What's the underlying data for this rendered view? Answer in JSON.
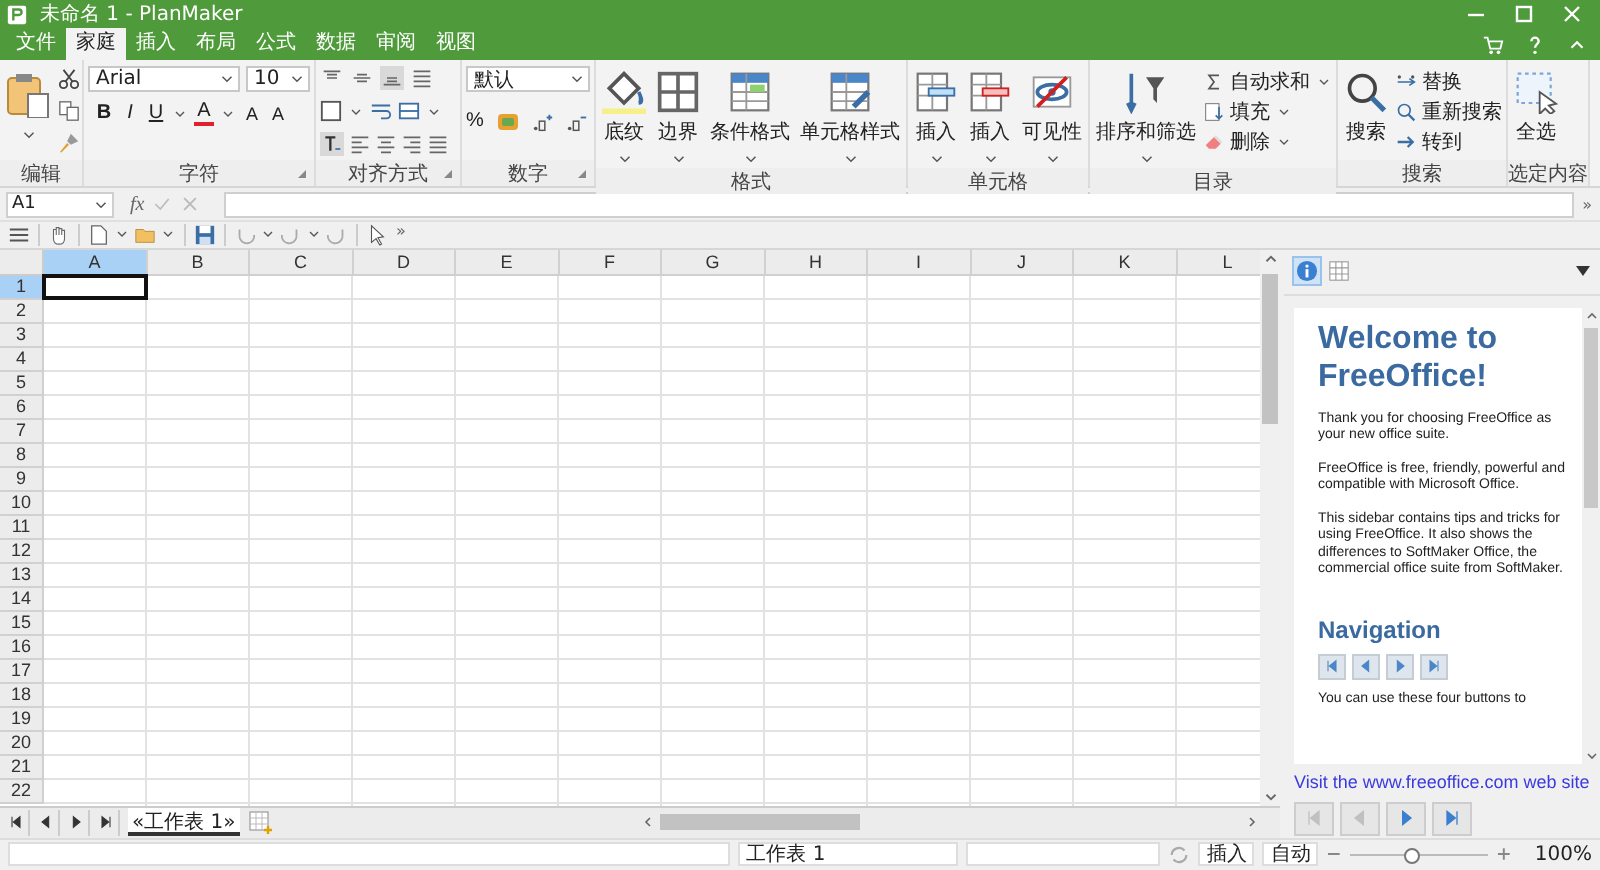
{
  "window": {
    "title": "未命名 1 - PlanMaker"
  },
  "ribbon_tabs": [
    {
      "label": "文件",
      "selected": false
    },
    {
      "label": "家庭",
      "selected": true
    },
    {
      "label": "插入",
      "selected": false
    },
    {
      "label": "布局",
      "selected": false
    },
    {
      "label": "公式",
      "selected": false
    },
    {
      "label": "数据",
      "selected": false
    },
    {
      "label": "审阅",
      "selected": false
    },
    {
      "label": "视图",
      "selected": false
    }
  ],
  "ribbon_groups": [
    {
      "kind": "edit",
      "label": "编辑"
    },
    {
      "kind": "character",
      "label": "字符",
      "font": "Arial",
      "size": "10",
      "buttons": [
        {
          "kind": "bold",
          "text": "B"
        },
        {
          "kind": "italic",
          "text": "I"
        },
        {
          "kind": "underline",
          "text": "U"
        },
        {
          "kind": "color",
          "text": "A"
        },
        {
          "kind": "grow",
          "text": "A"
        },
        {
          "kind": "shrink",
          "text": "A"
        }
      ]
    },
    {
      "kind": "alignment",
      "label": "对齐方式",
      "vertical": [
        {
          "selected": false
        },
        {
          "selected": false
        },
        {
          "selected": true
        },
        {
          "selected": false
        }
      ],
      "rotate_selected": true
    },
    {
      "kind": "number",
      "label": "数字",
      "format": "默认",
      "percent": "%"
    },
    {
      "kind": "large",
      "label": "格式",
      "buttons": [
        "底纹",
        "边界",
        "条件格式",
        "单元格样式"
      ]
    },
    {
      "kind": "large",
      "label": "单元格",
      "buttons": [
        "插入",
        "插入",
        "可见性"
      ]
    },
    {
      "kind": "mixed",
      "label": "目录",
      "large": "排序和筛选",
      "small": [
        "自动求和",
        "填充",
        "删除"
      ]
    },
    {
      "kind": "mixed",
      "label": "搜索",
      "large": "搜索",
      "small": [
        "替换",
        "重新搜索",
        "转到"
      ]
    },
    {
      "kind": "large",
      "label": "选定内容",
      "buttons": [
        "全选"
      ]
    }
  ],
  "formula_bar": {
    "cell": "A1",
    "fx": "fx",
    "overflow": "»"
  },
  "toolbar": {
    "overflow": "»"
  },
  "columns": [
    {
      "label": "A",
      "selected": true
    },
    {
      "label": "B",
      "selected": false
    },
    {
      "label": "C",
      "selected": false
    },
    {
      "label": "D",
      "selected": false
    },
    {
      "label": "E",
      "selected": false
    },
    {
      "label": "F",
      "selected": false
    },
    {
      "label": "G",
      "selected": false
    },
    {
      "label": "H",
      "selected": false
    },
    {
      "label": "I",
      "selected": false
    },
    {
      "label": "J",
      "selected": false
    },
    {
      "label": "K",
      "selected": false
    },
    {
      "label": "L",
      "selected": false
    }
  ],
  "rows": [
    {
      "label": "1",
      "selected": true
    },
    {
      "label": "2",
      "selected": false
    },
    {
      "label": "3",
      "selected": false
    },
    {
      "label": "4",
      "selected": false
    },
    {
      "label": "5",
      "selected": false
    },
    {
      "label": "6",
      "selected": false
    },
    {
      "label": "7",
      "selected": false
    },
    {
      "label": "8",
      "selected": false
    },
    {
      "label": "9",
      "selected": false
    },
    {
      "label": "10",
      "selected": false
    },
    {
      "label": "11",
      "selected": false
    },
    {
      "label": "12",
      "selected": false
    },
    {
      "label": "13",
      "selected": false
    },
    {
      "label": "14",
      "selected": false
    },
    {
      "label": "15",
      "selected": false
    },
    {
      "label": "16",
      "selected": false
    },
    {
      "label": "17",
      "selected": false
    },
    {
      "label": "18",
      "selected": false
    },
    {
      "label": "19",
      "selected": false
    },
    {
      "label": "20",
      "selected": false
    },
    {
      "label": "21",
      "selected": false
    },
    {
      "label": "22",
      "selected": false
    }
  ],
  "sheet_tabs": [
    {
      "label": "«工作表 1»",
      "selected": true
    }
  ],
  "sidebar": {
    "tabs": [
      {
        "selected": true
      },
      {
        "selected": false
      }
    ],
    "heading": "Welcome to FreeOffice!",
    "paragraphs": [
      "Thank you for choosing FreeOffice as your new office suite.",
      "FreeOffice is free, friendly, powerful and compatible with Microsoft Office.",
      "This sidebar contains tips and tricks for using FreeOffice. It also shows the differences to SoftMaker Office, the commercial office suite from SoftMaker."
    ],
    "subheading": "Navigation",
    "inner_nav": [
      {
        "disabled": false
      },
      {
        "disabled": false
      },
      {
        "disabled": false
      },
      {
        "disabled": false
      }
    ],
    "last_line": "You can use these four buttons to",
    "link": "Visit the www.freeoffice.com web site",
    "nav": [
      {
        "disabled": true
      },
      {
        "disabled": true
      },
      {
        "disabled": false
      },
      {
        "disabled": false
      }
    ]
  },
  "status_bar": {
    "sheet": "工作表 1",
    "mode": "插入",
    "calc": "自动",
    "zoom_slider": {
      "level": 0.45
    },
    "zoom": "100%"
  }
}
